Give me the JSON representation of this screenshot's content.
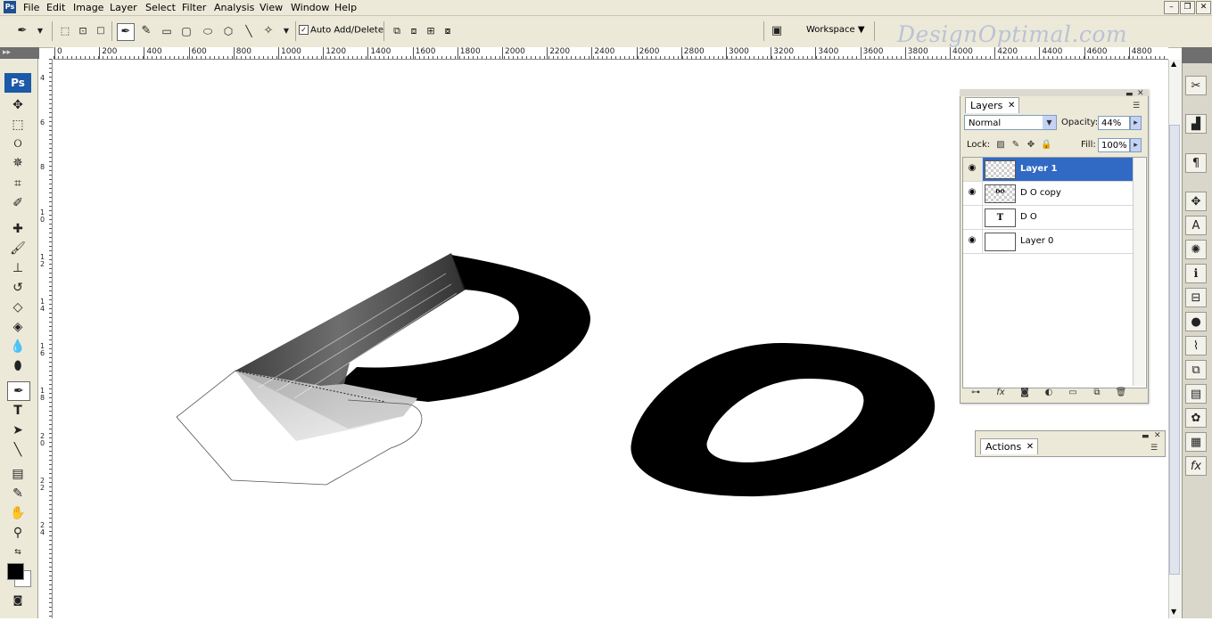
{
  "app": {
    "logo": "Ps"
  },
  "menu": [
    "File",
    "Edit",
    "Image",
    "Layer",
    "Select",
    "Filter",
    "Analysis",
    "View",
    "Window",
    "Help"
  ],
  "window_controls": {
    "minimize": "–",
    "restore": "❐",
    "close": "✕"
  },
  "options_bar": {
    "auto_add_delete_label": "Auto Add/Delete",
    "auto_add_delete_checked": true,
    "workspace_label": "Workspace ▼",
    "watermark": "DesignOptimal.com"
  },
  "ruler_top": [
    "0",
    "200",
    "400",
    "600",
    "800",
    "1000",
    "1200",
    "1400",
    "1600",
    "1800",
    "2000",
    "2200",
    "2400",
    "2600",
    "2800",
    "3000",
    "3200",
    "3400",
    "3600",
    "3800",
    "4000",
    "4200",
    "4400",
    "4600",
    "4800"
  ],
  "ruler_left": [
    "4",
    "6",
    "8",
    "1 0",
    "1 2",
    "1 4",
    "1 6",
    "1 8",
    "2 0",
    "2 2",
    "2 4"
  ],
  "tools_panel": {
    "collapse": "▸▸",
    "badge": "Ps"
  },
  "tools": [
    "move-tool",
    "marquee-tool",
    "lasso-tool",
    "magic-wand-tool",
    "crop-tool",
    "slice-tool",
    "healing-brush-tool",
    "brush-tool",
    "clone-stamp-tool",
    "history-brush-tool",
    "eraser-tool",
    "paint-bucket-tool",
    "blur-tool",
    "dodge-tool",
    "pen-tool",
    "type-tool",
    "path-selection-tool",
    "line-tool",
    "notes-tool",
    "eyedropper-tool",
    "hand-tool",
    "zoom-tool"
  ],
  "colors": {
    "foreground": "#000000",
    "background": "#ffffff",
    "selection": "#316ac5"
  },
  "layers_panel": {
    "tab": "Layers",
    "blend_mode": "Normal",
    "opacity_label": "Opacity:",
    "opacity_value": "44%",
    "lock_label": "Lock:",
    "fill_label": "Fill:",
    "fill_value": "100%",
    "layers": [
      {
        "name": "Layer 1",
        "visible": true,
        "selected": true,
        "thumb": ""
      },
      {
        "name": "D O copy",
        "visible": true,
        "selected": false,
        "thumb": "ᴰᴼ"
      },
      {
        "name": "D O",
        "visible": false,
        "selected": false,
        "thumb": "T"
      },
      {
        "name": "Layer 0",
        "visible": true,
        "selected": false,
        "thumb": ""
      }
    ]
  },
  "actions_panel": {
    "tab": "Actions"
  }
}
